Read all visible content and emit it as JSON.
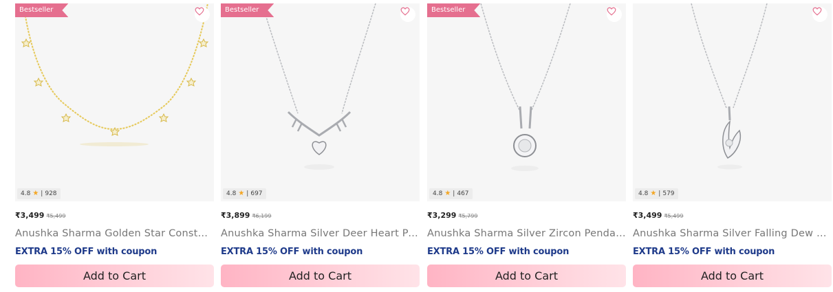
{
  "products": [
    {
      "badge": "Bestseller",
      "rating": "4.8",
      "reviews": "928",
      "price": "₹3,499",
      "mrp": "₹5,499",
      "title": "Anushka Sharma Golden Star Constellation Necklace",
      "offer": "EXTRA 15% OFF with coupon",
      "cta": "Add to Cart"
    },
    {
      "badge": "Bestseller",
      "rating": "4.8",
      "reviews": "697",
      "price": "₹3,899",
      "mrp": "₹6,199",
      "title": "Anushka Sharma Silver Deer Heart Pendant",
      "offer": "EXTRA 15% OFF with coupon",
      "cta": "Add to Cart"
    },
    {
      "badge": "Bestseller",
      "rating": "4.8",
      "reviews": "467",
      "price": "₹3,299",
      "mrp": "₹5,799",
      "title": "Anushka Sharma Silver Zircon Pendant",
      "offer": "EXTRA 15% OFF with coupon",
      "cta": "Add to Cart"
    },
    {
      "badge": "",
      "rating": "4.8",
      "reviews": "579",
      "price": "₹3,499",
      "mrp": "₹5,499",
      "title": "Anushka Sharma Silver Falling Dew Pendant",
      "offer": "EXTRA 15% OFF with coupon",
      "cta": "Add to Cart"
    }
  ],
  "colors": {
    "badge": "#e56f8f",
    "offer": "#1e3a8a",
    "star": "#f4a623",
    "cta": "#ffb4c4"
  },
  "icons": {
    "wishlist": "heart-outline-icon",
    "rating": "star-icon"
  }
}
